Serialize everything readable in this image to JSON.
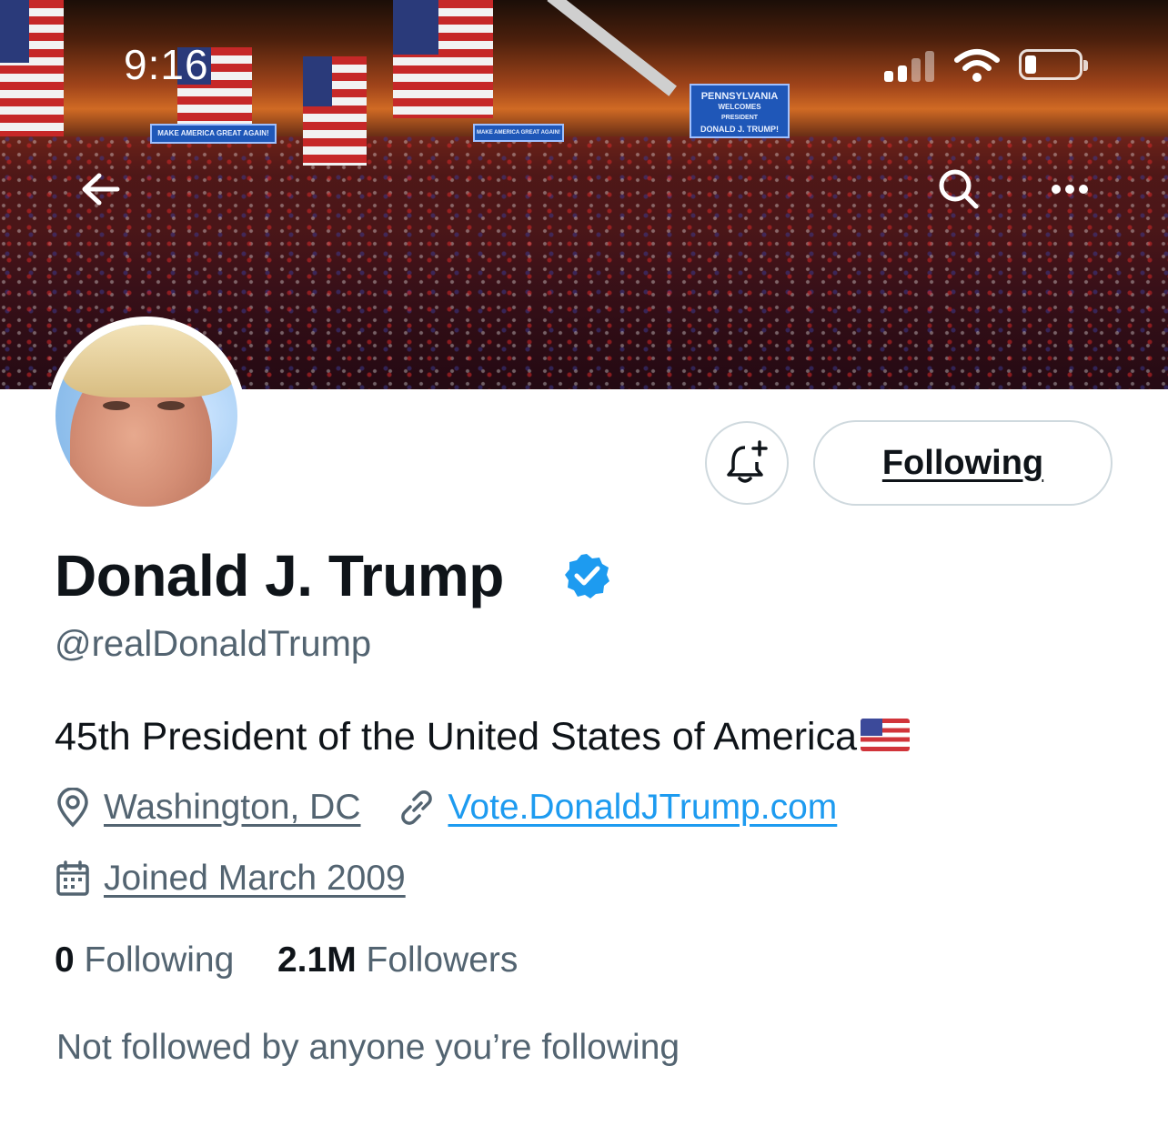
{
  "status_bar": {
    "time": "9:16"
  },
  "banner": {
    "signs": {
      "left": "MAKE AMERICA GREAT AGAIN!",
      "middle": "MAKE AMERICA GREAT AGAIN!",
      "main": [
        "PENNSYLVANIA",
        "WELCOMES",
        "PRESIDENT",
        "DONALD J. TRUMP!"
      ]
    }
  },
  "header_actions": {
    "back_icon": "arrow-left-icon",
    "search_icon": "search-icon",
    "more_icon": "more-icon"
  },
  "profile": {
    "name": "Donald J. Trump",
    "handle": "@realDonaldTrump",
    "verified": true,
    "bio": "45th President of the United States of America",
    "location": "Washington, DC",
    "website": "Vote.DonaldJTrump.com",
    "joined": "Joined March 2009",
    "following_count": "0",
    "following_label": "Following",
    "followers_count": "2.1M",
    "followers_label": "Followers",
    "followed_by_note": "Not followed by anyone you’re following"
  },
  "buttons": {
    "follow_state": "Following"
  },
  "colors": {
    "accent": "#1d9bf0",
    "secondary_text": "#536471",
    "primary_text": "#0f1419",
    "border": "#cfd9de"
  }
}
